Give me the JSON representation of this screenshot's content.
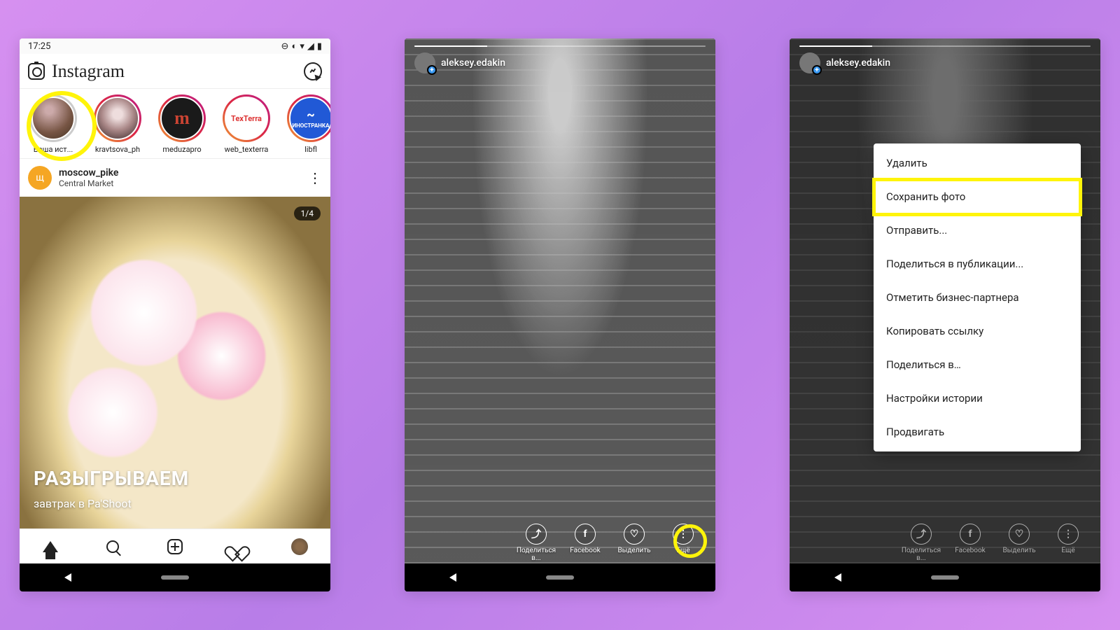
{
  "screen1": {
    "status_time": "17:25",
    "app_name": "Instagram",
    "stories": [
      {
        "label": "Ваша ист..."
      },
      {
        "label": "kravtsova_ph"
      },
      {
        "label": "meduzapro"
      },
      {
        "label": "web_texterra"
      },
      {
        "label": "libfl"
      }
    ],
    "story_badge_texterra": "TexTerra",
    "story_badge_meduza": "m",
    "story_badge_libfl_top": "~",
    "story_badge_libfl_bot": "ИНОСТРАНКА",
    "post": {
      "avatar_letter": "щ",
      "username": "moscow_pike",
      "location": "Central Market",
      "counter": "1/4",
      "title": "РАЗЫГРЫВАЕМ",
      "subtitle": "завтрак в Pa'Shoot"
    }
  },
  "screen2": {
    "username": "aleksey.edakin",
    "actions": {
      "share": "Поделиться в...",
      "facebook": "Facebook",
      "highlight": "Выделить",
      "more": "Ещё"
    }
  },
  "screen3": {
    "username": "aleksey.edakin",
    "menu": [
      "Удалить",
      "Сохранить фото",
      "Отправить...",
      "Поделиться в публикации...",
      "Отметить бизнес-партнера",
      "Копировать ссылку",
      "Поделиться в…",
      "Настройки истории",
      "Продвигать"
    ],
    "actions": {
      "share": "Поделиться в...",
      "facebook": "Facebook",
      "highlight": "Выделить",
      "more": "Ещё"
    }
  }
}
